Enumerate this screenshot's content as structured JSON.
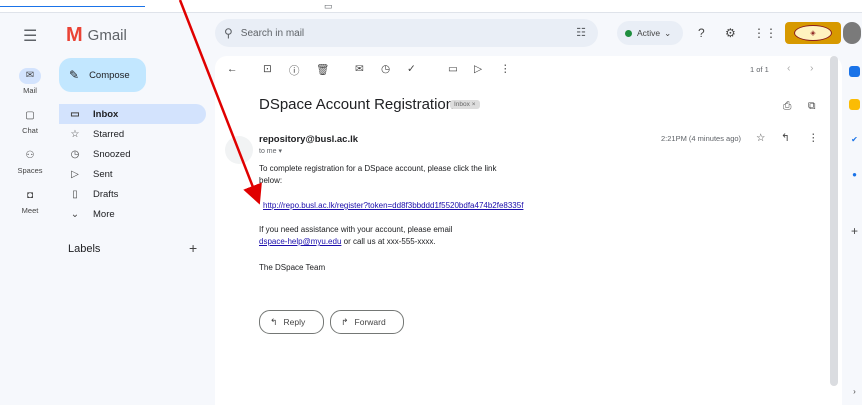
{
  "app": {
    "name": "Gmail"
  },
  "rail": {
    "items": [
      {
        "label": "Mail",
        "icon": "mail-icon",
        "active": true
      },
      {
        "label": "Chat",
        "icon": "chat-icon",
        "active": false
      },
      {
        "label": "Spaces",
        "icon": "spaces-icon",
        "active": false
      },
      {
        "label": "Meet",
        "icon": "meet-icon",
        "active": false
      }
    ]
  },
  "compose": {
    "label": "Compose"
  },
  "nav": {
    "items": [
      {
        "label": "Inbox",
        "icon": "inbox-icon",
        "active": true
      },
      {
        "label": "Starred",
        "icon": "star-icon",
        "active": false
      },
      {
        "label": "Snoozed",
        "icon": "clock-icon",
        "active": false
      },
      {
        "label": "Sent",
        "icon": "send-icon",
        "active": false
      },
      {
        "label": "Drafts",
        "icon": "draft-icon",
        "active": false
      },
      {
        "label": "More",
        "icon": "chevron-down-icon",
        "active": false
      }
    ]
  },
  "labels": {
    "title": "Labels"
  },
  "search": {
    "placeholder": "Search in mail"
  },
  "status": {
    "label": "Active",
    "color": "#1e8e3e"
  },
  "pager": {
    "text": "1 of 1"
  },
  "email": {
    "subject": "DSpace Account Registration",
    "chip": "Inbox ×",
    "sender": "repository@busl.ac.lk",
    "to": "to me",
    "time": "2:21PM (4 minutes ago)",
    "line1": "To complete registration for a DSpace account, please click the link",
    "line2": "below:",
    "link": "http://repo.busl.ac.lk/register?token=dd8f3bbddd1f5520bdfa474b2fe8335f",
    "help1": "If you need assistance with your account, please email",
    "help_email": "dspace-help@myu.edu",
    "help2": " or call us at xxx-555-xxxx.",
    "signature": "The DSpace Team"
  },
  "actions": {
    "reply": "Reply",
    "forward": "Forward"
  },
  "colors": {
    "accent": "#c2e7ff",
    "active_nav": "#d3e3fd",
    "annotation_arrow": "#e00000"
  }
}
